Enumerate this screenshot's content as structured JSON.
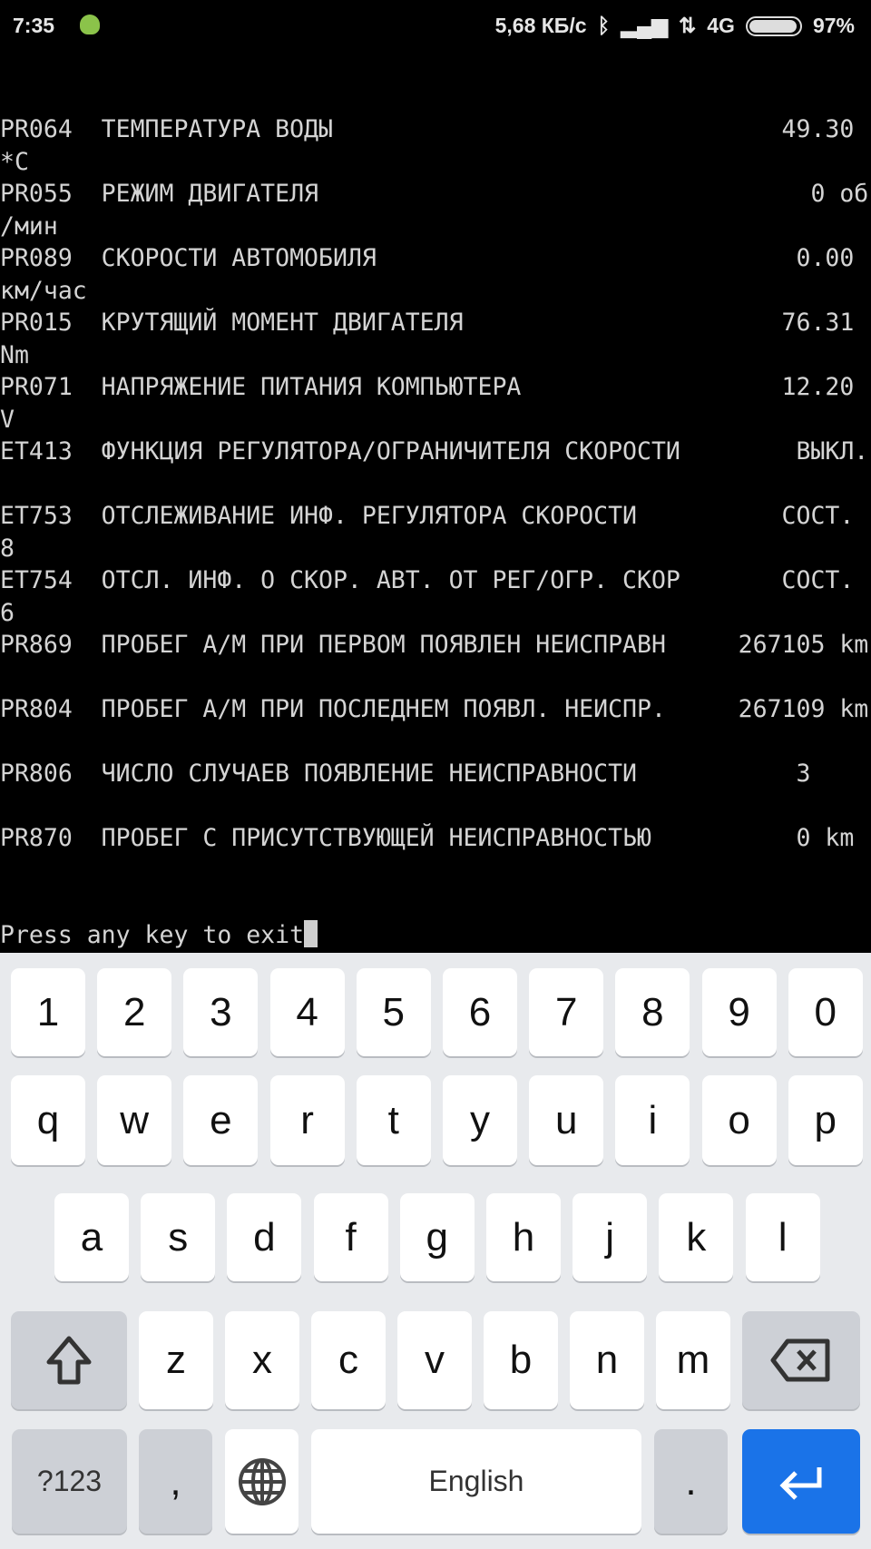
{
  "status": {
    "time": "7:35",
    "speed": "5,68 КБ/с",
    "network": "4G",
    "battery": "97%",
    "battery_level": 0.97
  },
  "terminal": {
    "rows": [
      "PR064  ТЕМПЕРАТУРА ВОДЫ                               49.30",
      "*C",
      "PR055  РЕЖИМ ДВИГАТЕЛЯ                                  0 об",
      "/мин",
      "PR089  СКОРОСТИ АВТОМОБИЛЯ                             0.00",
      "км/час",
      "PR015  КРУТЯЩИЙ МОМЕНТ ДВИГАТЕЛЯ                      76.31",
      "Nm",
      "PR071  НАПРЯЖЕНИЕ ПИТАНИЯ КОМПЬЮТЕРА                  12.20",
      "V",
      "ET413  ФУНКЦИЯ РЕГУЛЯТОРА/ОГРАНИЧИТЕЛЯ СКОРОСТИ        ВЫКЛ.",
      "",
      "ET753  ОТСЛЕЖИВАНИЕ ИНФ. РЕГУЛЯТОРА СКОРОСТИ          СОСТ.",
      "8",
      "ET754  ОТСЛ. ИНФ. О СКОР. АВТ. ОТ РЕГ/ОГР. СКОР       СОСТ.",
      "6",
      "PR869  ПРОБЕГ А/М ПРИ ПЕРВОМ ПОЯВЛЕН НЕИСПРАВН     267105 km",
      "",
      "PR804  ПРОБЕГ А/М ПРИ ПОСЛЕДНЕМ ПОЯВЛ. НЕИСПР.     267109 km",
      "",
      "PR806  ЧИСЛО СЛУЧАЕВ ПОЯВЛЕНИЕ НЕИСПРАВНОСТИ           3",
      "",
      "PR870  ПРОБЕГ С ПРИСУТСТВУЮЩЕЙ НЕИСПРАВНОСТЬЮ          0 km",
      "",
      ""
    ],
    "prompt": "Press any key to exit"
  },
  "keyboard": {
    "digits": [
      "1",
      "2",
      "3",
      "4",
      "5",
      "6",
      "7",
      "8",
      "9",
      "0"
    ],
    "row1": [
      "q",
      "w",
      "e",
      "r",
      "t",
      "y",
      "u",
      "i",
      "o",
      "p"
    ],
    "row2": [
      "a",
      "s",
      "d",
      "f",
      "g",
      "h",
      "j",
      "k",
      "l"
    ],
    "row3": [
      "z",
      "x",
      "c",
      "v",
      "b",
      "n",
      "m"
    ],
    "symbols": "?123",
    "comma": ",",
    "space": "English",
    "period": ".",
    "enter_color": "#1a73e8"
  }
}
